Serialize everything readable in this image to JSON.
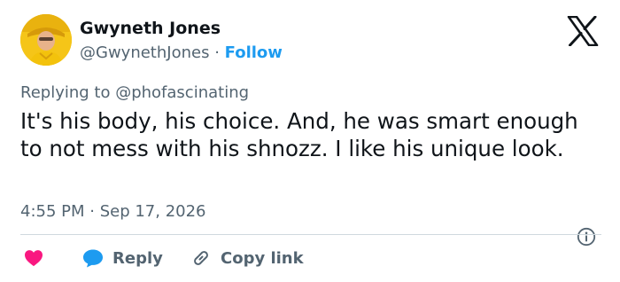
{
  "author": {
    "name": "Gwyneth Jones",
    "handle": "@GwynethJones",
    "separator": "·",
    "follow_label": "Follow"
  },
  "reply_context": {
    "prefix": "Replying to ",
    "target": "@phofascinating"
  },
  "tweet": {
    "text": "It's his body, his choice. And, he was smart enough to not mess with his shnozz. I like his unique look.",
    "timestamp": "4:55 PM · Sep 17, 2026"
  },
  "actions": {
    "reply_label": "Reply",
    "copy_link_label": "Copy link"
  },
  "icons": {
    "brand": "x-logo-icon",
    "info": "info-icon",
    "like": "heart-icon",
    "reply": "speech-bubble-icon",
    "copy": "link-icon"
  },
  "colors": {
    "text": "#0f1419",
    "secondary": "#536471",
    "accent": "#1d9bf0",
    "like": "#f91880",
    "divider": "#cfd9de"
  }
}
